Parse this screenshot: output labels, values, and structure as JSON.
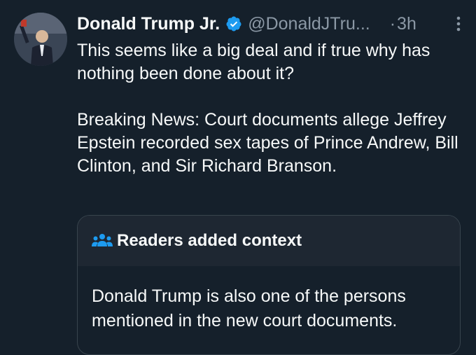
{
  "tweet": {
    "author_name": "Donald Trump Jr.",
    "handle": "@DonaldJTru...",
    "separator": "·",
    "time": "3h",
    "verified": true,
    "text_paragraphs": [
      "This seems like a big deal and if true why has nothing been done about it?",
      "Breaking News: Court documents allege Jeffrey Epstein recorded sex tapes of Prince Andrew, Bill Clinton, and Sir Richard Branson."
    ]
  },
  "community_note": {
    "title": "Readers added context",
    "body": "Donald Trump is also one of the persons mentioned in the new court documents."
  },
  "colors": {
    "background": "#15202b",
    "text_primary": "#f7f9f9",
    "text_secondary": "#8b98a5",
    "verified_badge": "#1d9bf0",
    "note_header_bg": "#1e2732",
    "note_icon": "#1d9bf0",
    "border": "#38444d"
  },
  "icons": {
    "verified": "verified-badge-icon",
    "more": "more-options-icon",
    "note": "people-icon"
  }
}
